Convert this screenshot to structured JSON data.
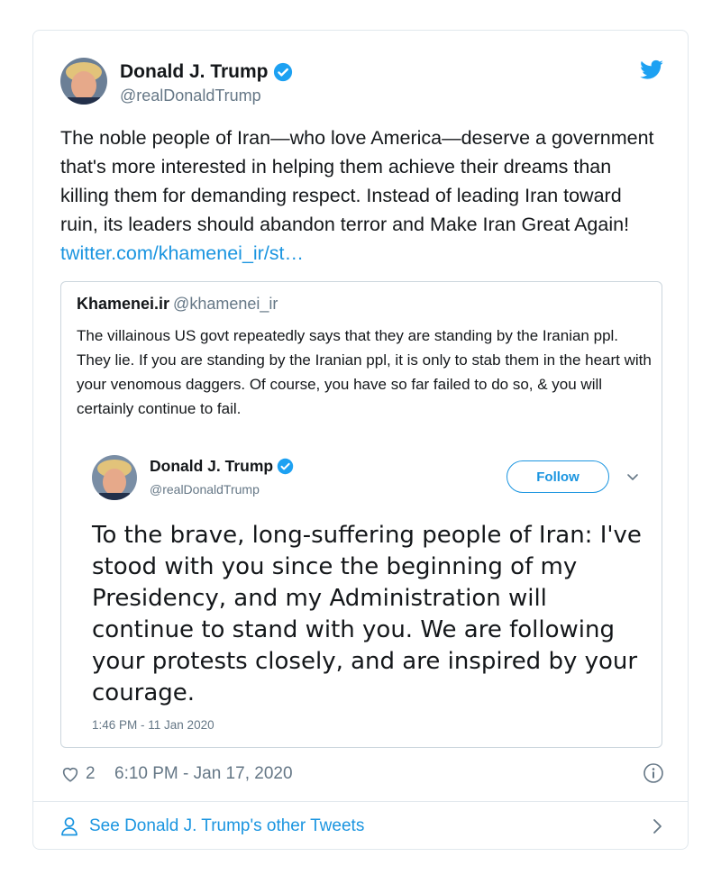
{
  "tweet": {
    "author_name": "Donald J. Trump",
    "author_handle": "@realDonaldTrump",
    "text": "The noble people of Iran—who love America—deserve a government that's more interested in helping them achieve their dreams than killing them for demanding respect. Instead of leading Iran toward ruin, its leaders should abandon terror and Make Iran Great Again! ",
    "link_text": "twitter.com/khamenei_ir/st…",
    "likes": "2",
    "timestamp": "6:10 PM - Jan 17, 2020"
  },
  "quote": {
    "author_name": "Khamenei.ir",
    "author_handle": "@khamenei_ir",
    "text": "The villainous US govt repeatedly says that they are standing by the Iranian ppl. They lie. If you are standing by the Iranian ppl, it is only to stab them in the heart with your venomous daggers. Of course, you have so far failed to do so, & you will certainly continue to fail."
  },
  "embedded": {
    "author_name": "Donald J. Trump",
    "author_handle": "@realDonaldTrump",
    "follow_label": "Follow",
    "text": "To the brave, long-suffering people of Iran: I've stood with you since the beginning of my Presidency, and my Administration will continue to stand with you. We are following your protests closely, and are inspired by your courage.",
    "timestamp": "1:46 PM - 11 Jan 2020"
  },
  "footer": {
    "see_other_label": "See Donald J. Trump's other Tweets"
  },
  "icons": {
    "verified": "verified-badge-icon",
    "brand": "twitter-bird-icon",
    "like": "heart-icon",
    "info": "info-icon",
    "profile": "person-icon",
    "more": "chevron-down-icon",
    "next": "chevron-right-icon"
  },
  "colors": {
    "accent": "#1b95e0",
    "secondary_text": "#657786",
    "border": "#e1e8ed"
  }
}
